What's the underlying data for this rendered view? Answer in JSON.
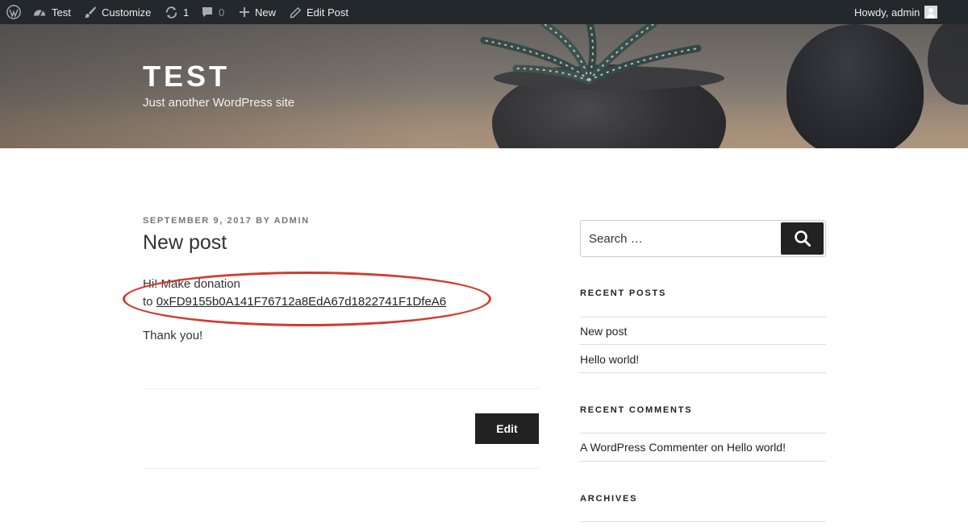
{
  "admin_bar": {
    "site_name": "Test",
    "customize": "Customize",
    "updates": "1",
    "comments": "0",
    "new": "New",
    "edit_post": "Edit Post",
    "greeting": "Howdy, admin"
  },
  "header": {
    "title": "TEST",
    "description": "Just another WordPress site"
  },
  "post": {
    "meta": "SEPTEMBER 9, 2017 BY ADMIN",
    "title": "New post",
    "line1": "Hi! Make donation",
    "to_prefix": "to ",
    "address_link": "0xFD9155b0A141F76712a8EdA67d1822741F1DfeA6",
    "thanks": "Thank you!",
    "edit_label": "Edit"
  },
  "sidebar": {
    "search_placeholder": "Search …",
    "recent_posts_title": "RECENT POSTS",
    "recent_posts": [
      "New post",
      "Hello world!"
    ],
    "recent_comments_title": "RECENT COMMENTS",
    "comment_author": "A WordPress Commenter",
    "comment_on": " on ",
    "comment_post": "Hello world!",
    "archives_title": "ARCHIVES"
  },
  "colors": {
    "admin_bar_bg": "#23282d",
    "annotation": "#d23b2f",
    "button_bg": "#222222"
  }
}
